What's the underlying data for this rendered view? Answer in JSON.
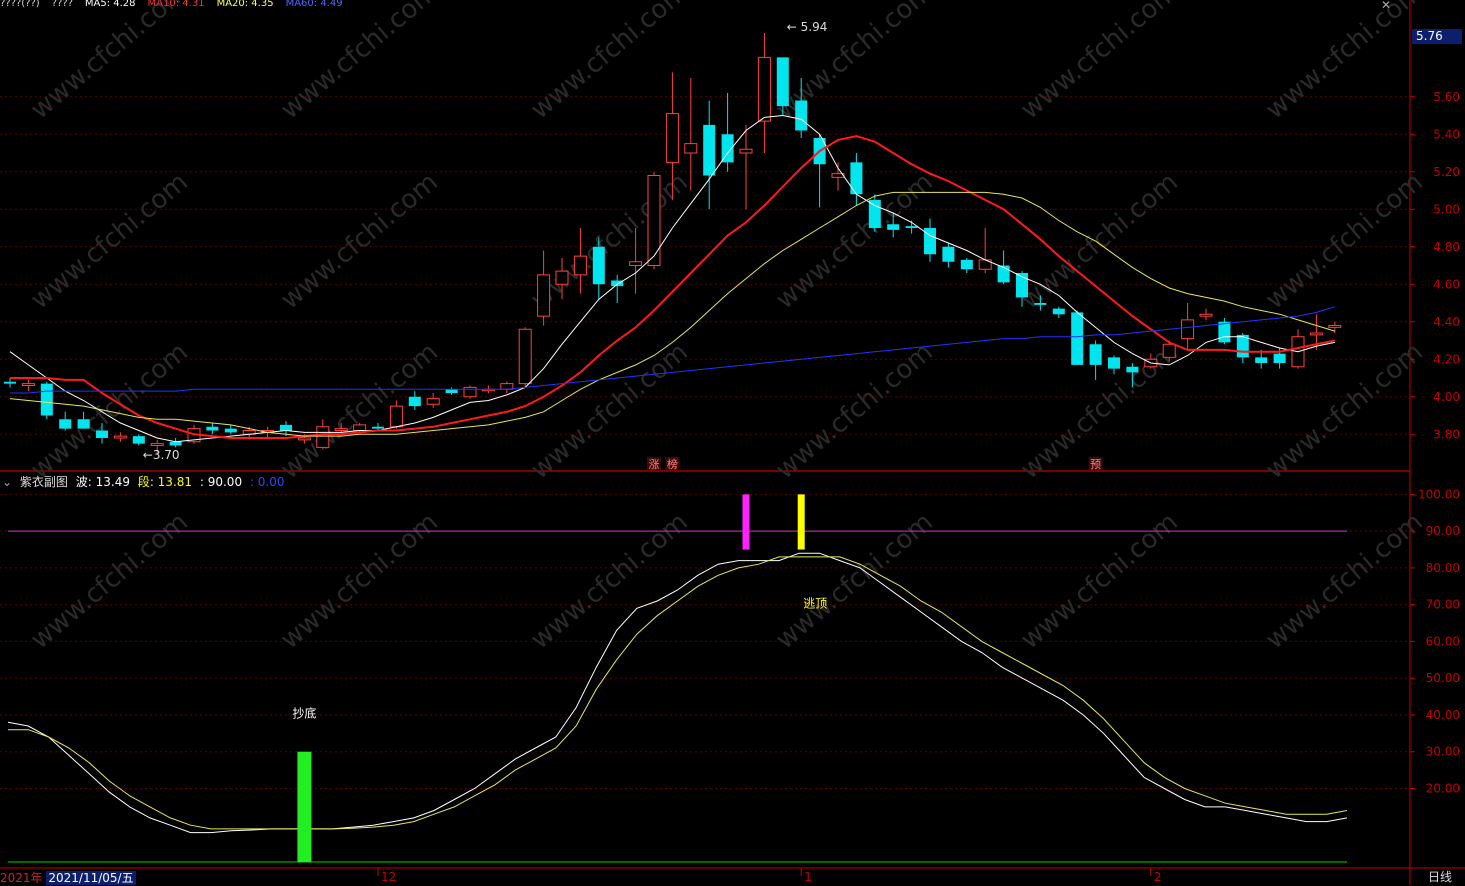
{
  "header": {
    "tokens": [
      {
        "text": "????(??)",
        "color": "#d8d8d8"
      },
      {
        "text": "????",
        "color": "#d8d8d8"
      },
      {
        "text": "MA5: 4.28",
        "color": "#ffffff"
      },
      {
        "text": "MA10: 4.31",
        "color": "#ff3030"
      },
      {
        "text": "MA20: 4.35",
        "color": "#ffff66"
      },
      {
        "text": "MA60: 4.49",
        "color": "#4a6bff"
      }
    ]
  },
  "colors": {
    "up": "#ff4040",
    "down": "#00e5ee",
    "ma5": "#ffffff",
    "ma10": "#ff1a1a",
    "ma20": "#e6e65a",
    "ma60": "#2233ff",
    "axis": "#c00000",
    "grid": "#5a0000"
  },
  "chart_data": [
    {
      "type": "candlestick",
      "ylim": [
        3.62,
        6.02
      ],
      "y_ticks": [
        "3.80",
        "4.00",
        "4.20",
        "4.40",
        "4.60",
        "4.80",
        "5.00",
        "5.20",
        "5.40",
        "5.60"
      ],
      "current_price_label": "5.76",
      "annotations": [
        {
          "text": "5.94",
          "x": 42,
          "y": 5.94
        },
        {
          "text": "3.70",
          "x": 7,
          "y": 3.7
        }
      ],
      "badges": [
        {
          "text": "涨",
          "x": 35,
          "color": "#ff8080"
        },
        {
          "text": "榜",
          "x": 36,
          "color": "#ff8080"
        },
        {
          "text": "预",
          "x": 59,
          "color": "#ff8080"
        }
      ],
      "candles": [
        {
          "o": 4.08,
          "h": 4.1,
          "l": 4.05,
          "c": 4.07
        },
        {
          "o": 4.06,
          "h": 4.09,
          "l": 4.03,
          "c": 4.07
        },
        {
          "o": 4.07,
          "h": 4.08,
          "l": 3.88,
          "c": 3.9
        },
        {
          "o": 3.88,
          "h": 3.92,
          "l": 3.82,
          "c": 3.83
        },
        {
          "o": 3.88,
          "h": 3.92,
          "l": 3.84,
          "c": 3.83
        },
        {
          "o": 3.82,
          "h": 3.86,
          "l": 3.75,
          "c": 3.78
        },
        {
          "o": 3.78,
          "h": 3.81,
          "l": 3.76,
          "c": 3.79
        },
        {
          "o": 3.79,
          "h": 3.8,
          "l": 3.74,
          "c": 3.75
        },
        {
          "o": 3.74,
          "h": 3.77,
          "l": 3.7,
          "c": 3.75
        },
        {
          "o": 3.76,
          "h": 3.78,
          "l": 3.73,
          "c": 3.74
        },
        {
          "o": 3.76,
          "h": 3.85,
          "l": 3.75,
          "c": 3.83
        },
        {
          "o": 3.84,
          "h": 3.86,
          "l": 3.8,
          "c": 3.82
        },
        {
          "o": 3.83,
          "h": 3.85,
          "l": 3.8,
          "c": 3.81
        },
        {
          "o": 3.8,
          "h": 3.84,
          "l": 3.78,
          "c": 3.82
        },
        {
          "o": 3.82,
          "h": 3.84,
          "l": 3.78,
          "c": 3.82
        },
        {
          "o": 3.85,
          "h": 3.87,
          "l": 3.79,
          "c": 3.82
        },
        {
          "o": 3.77,
          "h": 3.8,
          "l": 3.75,
          "c": 3.78
        },
        {
          "o": 3.73,
          "h": 3.88,
          "l": 3.72,
          "c": 3.84
        },
        {
          "o": 3.82,
          "h": 3.86,
          "l": 3.8,
          "c": 3.83
        },
        {
          "o": 3.82,
          "h": 3.86,
          "l": 3.81,
          "c": 3.85
        },
        {
          "o": 3.84,
          "h": 3.86,
          "l": 3.82,
          "c": 3.83
        },
        {
          "o": 3.84,
          "h": 3.98,
          "l": 3.83,
          "c": 3.95
        },
        {
          "o": 4.0,
          "h": 4.03,
          "l": 3.93,
          "c": 3.95
        },
        {
          "o": 3.96,
          "h": 4.02,
          "l": 3.94,
          "c": 3.99
        },
        {
          "o": 4.04,
          "h": 4.05,
          "l": 4.01,
          "c": 4.02
        },
        {
          "o": 4.0,
          "h": 4.06,
          "l": 3.99,
          "c": 4.05
        },
        {
          "o": 4.04,
          "h": 4.06,
          "l": 4.02,
          "c": 4.04
        },
        {
          "o": 4.04,
          "h": 4.08,
          "l": 4.02,
          "c": 4.07
        },
        {
          "o": 4.07,
          "h": 4.37,
          "l": 4.05,
          "c": 4.36
        },
        {
          "o": 4.43,
          "h": 4.78,
          "l": 4.38,
          "c": 4.65
        },
        {
          "o": 4.6,
          "h": 4.74,
          "l": 4.52,
          "c": 4.67
        },
        {
          "o": 4.65,
          "h": 4.9,
          "l": 4.55,
          "c": 4.75
        },
        {
          "o": 4.8,
          "h": 4.85,
          "l": 4.52,
          "c": 4.6
        },
        {
          "o": 4.62,
          "h": 4.65,
          "l": 4.5,
          "c": 4.59
        },
        {
          "o": 4.7,
          "h": 4.9,
          "l": 4.55,
          "c": 4.72
        },
        {
          "o": 4.7,
          "h": 5.2,
          "l": 4.68,
          "c": 5.18
        },
        {
          "o": 5.25,
          "h": 5.73,
          "l": 5.05,
          "c": 5.51
        },
        {
          "o": 5.3,
          "h": 5.7,
          "l": 5.1,
          "c": 5.35
        },
        {
          "o": 5.45,
          "h": 5.58,
          "l": 5.0,
          "c": 5.18
        },
        {
          "o": 5.4,
          "h": 5.62,
          "l": 5.2,
          "c": 5.25
        },
        {
          "o": 5.3,
          "h": 5.45,
          "l": 5.0,
          "c": 5.32
        },
        {
          "o": 5.47,
          "h": 5.94,
          "l": 5.3,
          "c": 5.81
        },
        {
          "o": 5.81,
          "h": 5.81,
          "l": 5.5,
          "c": 5.55
        },
        {
          "o": 5.58,
          "h": 5.7,
          "l": 5.38,
          "c": 5.42
        },
        {
          "o": 5.38,
          "h": 5.4,
          "l": 5.01,
          "c": 5.24
        },
        {
          "o": 5.17,
          "h": 5.25,
          "l": 5.1,
          "c": 5.19
        },
        {
          "o": 5.25,
          "h": 5.3,
          "l": 5.02,
          "c": 5.08
        },
        {
          "o": 5.05,
          "h": 5.08,
          "l": 4.88,
          "c": 4.9
        },
        {
          "o": 4.92,
          "h": 4.98,
          "l": 4.85,
          "c": 4.89
        },
        {
          "o": 4.91,
          "h": 4.94,
          "l": 4.87,
          "c": 4.9
        },
        {
          "o": 4.9,
          "h": 4.95,
          "l": 4.72,
          "c": 4.76
        },
        {
          "o": 4.8,
          "h": 4.82,
          "l": 4.69,
          "c": 4.72
        },
        {
          "o": 4.73,
          "h": 4.74,
          "l": 4.66,
          "c": 4.68
        },
        {
          "o": 4.68,
          "h": 4.9,
          "l": 4.66,
          "c": 4.73
        },
        {
          "o": 4.7,
          "h": 4.78,
          "l": 4.6,
          "c": 4.61
        },
        {
          "o": 4.66,
          "h": 4.67,
          "l": 4.48,
          "c": 4.53
        },
        {
          "o": 4.5,
          "h": 4.54,
          "l": 4.46,
          "c": 4.49
        },
        {
          "o": 4.47,
          "h": 4.48,
          "l": 4.42,
          "c": 4.44
        },
        {
          "o": 4.45,
          "h": 4.46,
          "l": 4.17,
          "c": 4.17
        },
        {
          "o": 4.28,
          "h": 4.3,
          "l": 4.09,
          "c": 4.17
        },
        {
          "o": 4.21,
          "h": 4.22,
          "l": 4.12,
          "c": 4.15
        },
        {
          "o": 4.16,
          "h": 4.18,
          "l": 4.05,
          "c": 4.13
        },
        {
          "o": 4.16,
          "h": 4.23,
          "l": 4.15,
          "c": 4.2
        },
        {
          "o": 4.21,
          "h": 4.3,
          "l": 4.19,
          "c": 4.28
        },
        {
          "o": 4.31,
          "h": 4.5,
          "l": 4.25,
          "c": 4.41
        },
        {
          "o": 4.43,
          "h": 4.47,
          "l": 4.41,
          "c": 4.44
        },
        {
          "o": 4.4,
          "h": 4.42,
          "l": 4.28,
          "c": 4.29
        },
        {
          "o": 4.33,
          "h": 4.34,
          "l": 4.18,
          "c": 4.21
        },
        {
          "o": 4.21,
          "h": 4.25,
          "l": 4.15,
          "c": 4.18
        },
        {
          "o": 4.23,
          "h": 4.26,
          "l": 4.15,
          "c": 4.18
        },
        {
          "o": 4.16,
          "h": 4.36,
          "l": 4.15,
          "c": 4.32
        },
        {
          "o": 4.33,
          "h": 4.44,
          "l": 4.25,
          "c": 4.34
        },
        {
          "o": 4.37,
          "h": 4.4,
          "l": 4.34,
          "c": 4.38
        }
      ],
      "series": [
        {
          "name": "MA5",
          "values": [
            4.24,
            4.17,
            4.1,
            4.03,
            3.98,
            3.92,
            3.86,
            3.82,
            3.78,
            3.76,
            3.77,
            3.78,
            3.79,
            3.8,
            3.81,
            3.82,
            3.81,
            3.81,
            3.81,
            3.82,
            3.82,
            3.84,
            3.86,
            3.89,
            3.93,
            3.97,
            3.98,
            4.01,
            4.05,
            4.15,
            4.28,
            4.4,
            4.52,
            4.6,
            4.66,
            4.75,
            4.9,
            5.03,
            5.16,
            5.3,
            5.42,
            5.49,
            5.5,
            5.48,
            5.4,
            5.22,
            5.08,
            5.02,
            4.98,
            4.93,
            4.86,
            4.82,
            4.78,
            4.73,
            4.69,
            4.64,
            4.6,
            4.54,
            4.45,
            4.37,
            4.29,
            4.23,
            4.18,
            4.17,
            4.22,
            4.29,
            4.32,
            4.32,
            4.29,
            4.26,
            4.24,
            4.27,
            4.29
          ]
        },
        {
          "name": "MA10",
          "values": [
            4.1,
            4.1,
            4.1,
            4.09,
            4.09,
            4.02,
            3.96,
            3.9,
            3.86,
            3.83,
            3.8,
            3.79,
            3.78,
            3.78,
            3.78,
            3.78,
            3.79,
            3.8,
            3.8,
            3.81,
            3.82,
            3.82,
            3.83,
            3.84,
            3.86,
            3.88,
            3.9,
            3.92,
            3.95,
            4.0,
            4.06,
            4.13,
            4.22,
            4.3,
            4.37,
            4.46,
            4.56,
            4.66,
            4.76,
            4.86,
            4.93,
            5.02,
            5.12,
            5.22,
            5.31,
            5.37,
            5.39,
            5.36,
            5.3,
            5.24,
            5.19,
            5.15,
            5.1,
            5.05,
            5.0,
            4.92,
            4.84,
            4.75,
            4.67,
            4.59,
            4.51,
            4.43,
            4.36,
            4.29,
            4.25,
            4.25,
            4.25,
            4.24,
            4.24,
            4.24,
            4.26,
            4.28,
            4.3
          ]
        },
        {
          "name": "MA20",
          "values": [
            3.99,
            3.98,
            3.97,
            3.96,
            3.95,
            3.93,
            3.91,
            3.89,
            3.88,
            3.88,
            3.87,
            3.86,
            3.85,
            3.83,
            3.81,
            3.8,
            3.79,
            3.79,
            3.79,
            3.8,
            3.8,
            3.8,
            3.81,
            3.82,
            3.83,
            3.84,
            3.85,
            3.87,
            3.89,
            3.92,
            3.98,
            4.04,
            4.09,
            4.13,
            4.17,
            4.22,
            4.29,
            4.37,
            4.46,
            4.55,
            4.63,
            4.71,
            4.78,
            4.84,
            4.9,
            4.96,
            5.02,
            5.07,
            5.09,
            5.09,
            5.09,
            5.09,
            5.09,
            5.09,
            5.08,
            5.06,
            5.01,
            4.94,
            4.88,
            4.83,
            4.76,
            4.69,
            4.63,
            4.58,
            4.55,
            4.53,
            4.51,
            4.48,
            4.46,
            4.44,
            4.41,
            4.38,
            4.35
          ]
        },
        {
          "name": "MA60",
          "values": [
            4.02,
            4.02,
            4.03,
            4.03,
            4.03,
            4.03,
            4.03,
            4.03,
            4.03,
            4.03,
            4.04,
            4.04,
            4.04,
            4.04,
            4.04,
            4.04,
            4.04,
            4.04,
            4.04,
            4.04,
            4.04,
            4.04,
            4.04,
            4.04,
            4.04,
            4.04,
            4.04,
            4.04,
            4.05,
            4.06,
            4.07,
            4.08,
            4.09,
            4.1,
            4.11,
            4.12,
            4.13,
            4.14,
            4.15,
            4.16,
            4.17,
            4.18,
            4.19,
            4.2,
            4.21,
            4.22,
            4.23,
            4.24,
            4.25,
            4.26,
            4.27,
            4.28,
            4.29,
            4.3,
            4.31,
            4.31,
            4.32,
            4.32,
            4.32,
            4.33,
            4.33,
            4.34,
            4.35,
            4.36,
            4.37,
            4.38,
            4.39,
            4.4,
            4.41,
            4.42,
            4.43,
            4.45,
            4.48
          ]
        }
      ]
    },
    {
      "type": "line",
      "title": "紫衣副图",
      "labels": [
        {
          "name": "波",
          "value": "13.49",
          "color": "#ffffff"
        },
        {
          "name": "段",
          "value": "13.81",
          "color": "#ffff00"
        },
        {
          "name": "",
          "value": "90.00",
          "color": "#ffffff"
        },
        {
          "name": "",
          "value": "0.00",
          "color": "#3344ff"
        }
      ],
      "ylim": [
        0,
        105
      ],
      "y_ticks": [
        "20.00",
        "30.00",
        "40.00",
        "50.00",
        "60.00",
        "70.00",
        "80.00",
        "90.00",
        "100.00"
      ],
      "reference_lines": [
        {
          "value": 90,
          "color": "#cc33cc"
        },
        {
          "value": 0,
          "color": "#00cc00"
        }
      ],
      "signals": [
        {
          "text": "抄底",
          "x": 16,
          "from": 0,
          "to": 30,
          "color": "#22ee22"
        },
        {
          "text": "",
          "x": 40,
          "from": 85,
          "to": 100,
          "color": "#ff22ff"
        },
        {
          "text": "逃顶",
          "x": 43,
          "from": 85,
          "to": 100,
          "color": "#ffff00"
        }
      ],
      "series": [
        {
          "name": "波",
          "values": [
            38,
            37,
            34,
            29,
            24,
            19,
            15,
            12,
            10,
            8,
            8,
            8.5,
            8.7,
            9,
            9,
            9,
            9,
            9.5,
            10,
            11,
            12,
            14,
            17,
            20,
            24,
            28,
            31,
            34,
            42,
            53,
            63,
            69,
            71,
            74,
            78,
            81,
            82,
            82,
            82,
            84,
            84,
            82,
            80,
            76,
            72,
            68,
            64,
            60,
            57,
            53,
            50,
            47,
            44,
            40,
            35,
            29,
            23,
            20,
            17,
            15,
            15,
            14,
            13,
            12,
            11,
            11,
            12
          ]
        },
        {
          "name": "段",
          "values": [
            36,
            36,
            34,
            31,
            27,
            22,
            18,
            15,
            12,
            10,
            9,
            9,
            9,
            9,
            9,
            9,
            9,
            9.2,
            9.5,
            10,
            11,
            13,
            15,
            18,
            21,
            25,
            28,
            31,
            37,
            47,
            55,
            62,
            67,
            71,
            75,
            78,
            80,
            81,
            83,
            83,
            83,
            83,
            81,
            78,
            75,
            71,
            68,
            64,
            60,
            57,
            54,
            51,
            48,
            44,
            39,
            33,
            27,
            23,
            20,
            18,
            16,
            15,
            14,
            13,
            13,
            13,
            14
          ]
        }
      ]
    }
  ],
  "xaxis": {
    "tick_labels": [
      {
        "text": "12",
        "x": 20
      },
      {
        "text": "1",
        "x": 43
      },
      {
        "text": "2",
        "x": 62
      }
    ]
  },
  "footer": {
    "year_label": "2021年",
    "date_label": "2021/11/05/五",
    "period_label": "日线"
  }
}
